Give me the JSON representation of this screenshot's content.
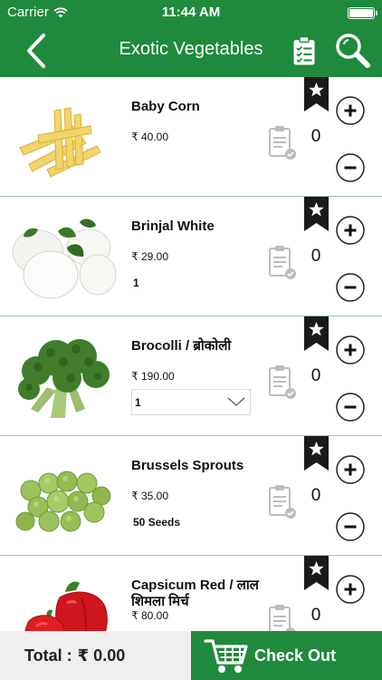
{
  "status_bar": {
    "carrier": "Carrier",
    "time": "11:44 AM",
    "wifi_icon": "wifi-icon",
    "battery_icon": "battery-icon"
  },
  "nav": {
    "title": "Exotic Vegetables",
    "back_icon": "chevron-left-icon",
    "list_icon": "checklist-icon",
    "search_icon": "search-icon"
  },
  "colors": {
    "primary_green": "#1f8a3c",
    "divider": "#9bc7a8",
    "total_bg": "#efefef"
  },
  "items": [
    {
      "name": "Baby Corn",
      "price": "₹ 40.00",
      "qty": "0"
    },
    {
      "name": "Brinjal White",
      "price": "₹ 29.00",
      "unit": "1",
      "qty": "0"
    },
    {
      "name": "Brocolli / ब्रोकोली",
      "price": "₹ 190.00",
      "unit_select": "1",
      "qty": "0"
    },
    {
      "name": "Brussels Sprouts",
      "price": "₹ 35.00",
      "unit": "50 Seeds",
      "qty": "0"
    },
    {
      "name": "Capsicum Red / लाल शिमला मिर्च",
      "price": "₹ 80.00",
      "qty": "0"
    }
  ],
  "footer": {
    "total_label": "Total :",
    "total_value": "₹ 0.00",
    "checkout_label": "Check Out",
    "cart_icon": "cart-icon"
  }
}
